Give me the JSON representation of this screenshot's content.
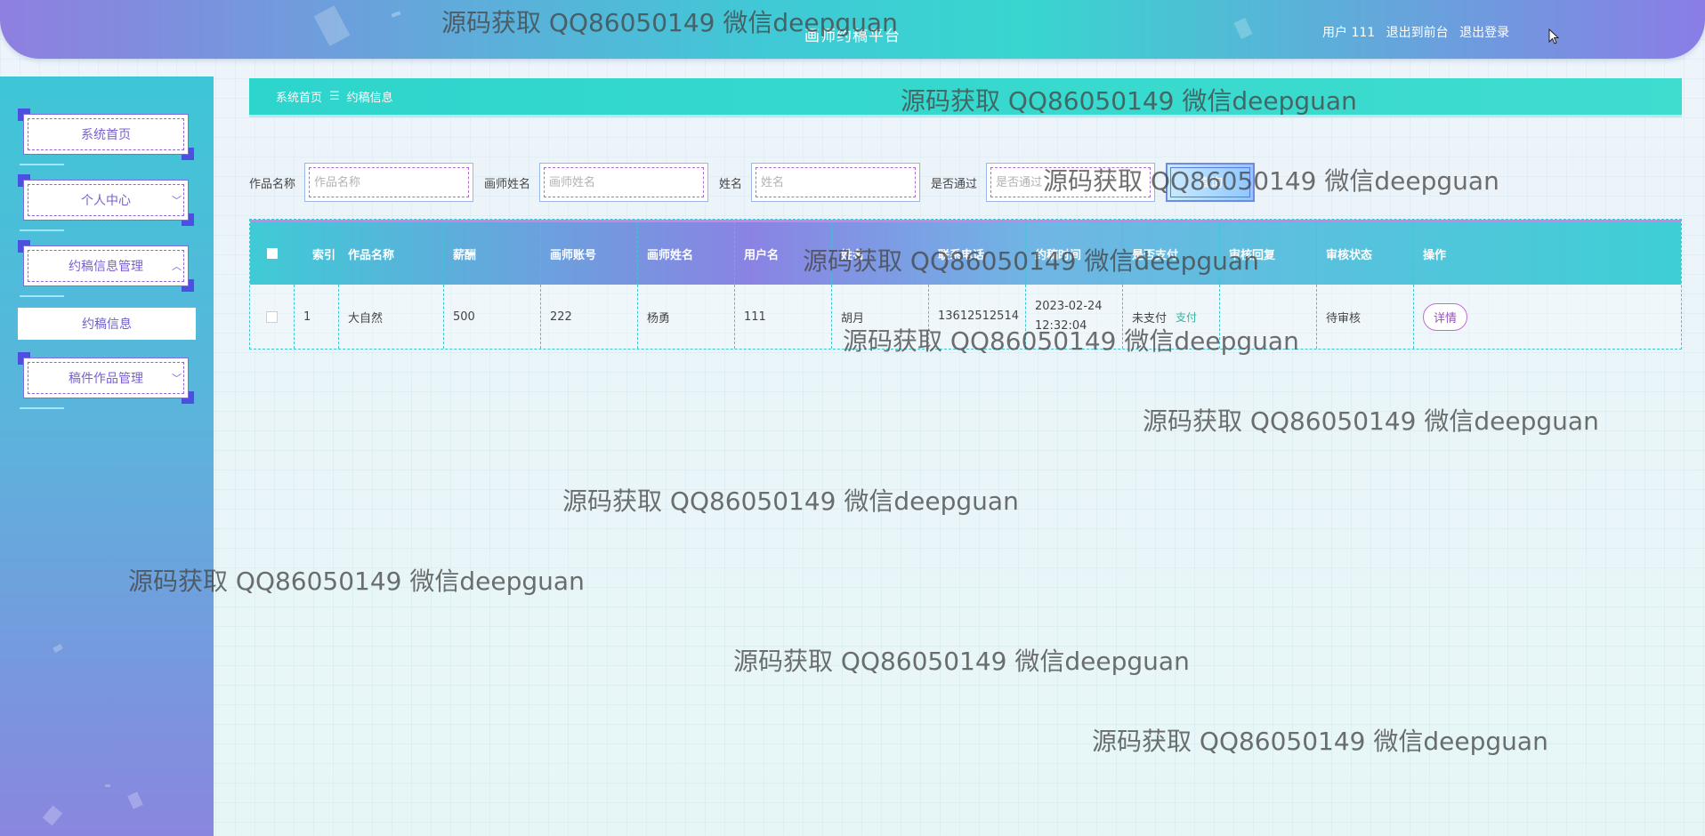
{
  "header": {
    "title": "画师约稿平台",
    "user_text": "用户 111",
    "back_link": "退出到前台",
    "logout_link": "退出登录"
  },
  "sidebar": {
    "items": [
      {
        "label": "系统首页"
      },
      {
        "label": "个人中心"
      },
      {
        "label": "约稿信息管理"
      },
      {
        "label": "稿件作品管理"
      }
    ],
    "submenu_label": "约稿信息"
  },
  "breadcrumb": {
    "home": "系统首页",
    "separator": "☰",
    "current": "约稿信息"
  },
  "search": {
    "work_label": "作品名称",
    "work_placeholder": "作品名称",
    "painter_label": "画师姓名",
    "painter_placeholder": "画师姓名",
    "name_label": "姓名",
    "name_placeholder": "姓名",
    "approved_label": "是否通过",
    "approved_placeholder": "是否通过",
    "query_button": "查询"
  },
  "table": {
    "columns": [
      "索引",
      "作品名称",
      "薪酬",
      "画师账号",
      "画师姓名",
      "用户名",
      "姓名",
      "联系电话",
      "约稿时间",
      "是否支付",
      "审核回复",
      "审核状态",
      "操作"
    ],
    "rows": [
      {
        "index": "1",
        "work": "大自然",
        "pay": "500",
        "painter_account": "222",
        "painter_name": "杨勇",
        "username": "111",
        "name": "胡月",
        "phone": "13612512514",
        "time": "2023-02-24 12:32:04",
        "paid": "未支付",
        "pay_link": "支付",
        "reply": "",
        "status": "待审核",
        "action": "详情"
      }
    ]
  },
  "watermark": "源码获取 QQ86050149 微信deepguan"
}
